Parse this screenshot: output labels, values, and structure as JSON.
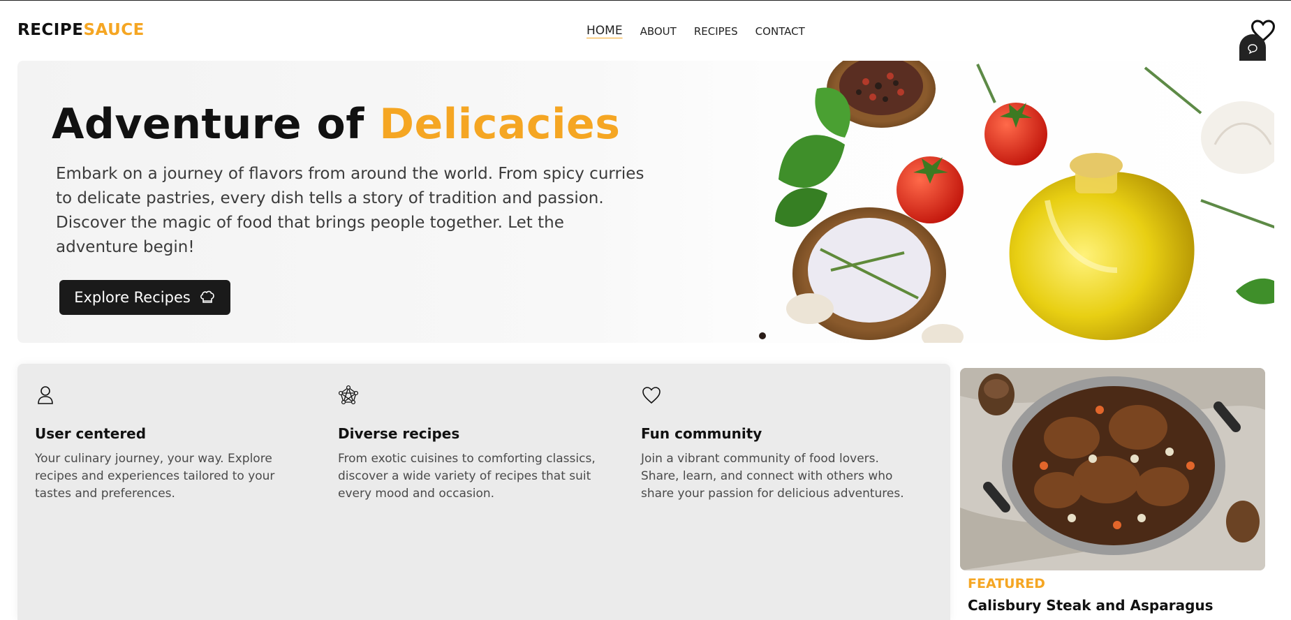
{
  "brand": {
    "part1": "RECIPE",
    "part2": "SAUCE",
    "accent": "#f5a623"
  },
  "nav": {
    "items": [
      "HOME",
      "ABOUT",
      "RECIPES",
      "CONTACT"
    ],
    "active": "HOME"
  },
  "toolbar_icons": [
    "chat-icon",
    "eye-icon",
    "list-icon"
  ],
  "hero": {
    "title_start": "Adventure of ",
    "title_highlight": "Delicacies",
    "text": "Embark on a journey of flavors from around the world. From spicy curries to delicate pastries, every dish tells a story of tradition and passion. Discover the magic of food that brings people together. Let the adventure begin!",
    "button_label": "Explore Recipes"
  },
  "features": [
    {
      "icon": "user-icon",
      "title": "User centered",
      "text": "Your culinary journey, your way. Explore recipes and experiences tailored to your tastes and preferences."
    },
    {
      "icon": "network-icon",
      "title": "Diverse recipes",
      "text": "From exotic cuisines to comforting classics, discover a wide variety of recipes that suit every mood and occasion."
    },
    {
      "icon": "heart-icon",
      "title": "Fun community",
      "text": "Join a vibrant community of food lovers. Share, learn, and connect with others who share your passion for delicious adventures."
    }
  ],
  "featured": {
    "tag": "FEATURED",
    "title": "Calisbury Steak and Asparagus"
  }
}
